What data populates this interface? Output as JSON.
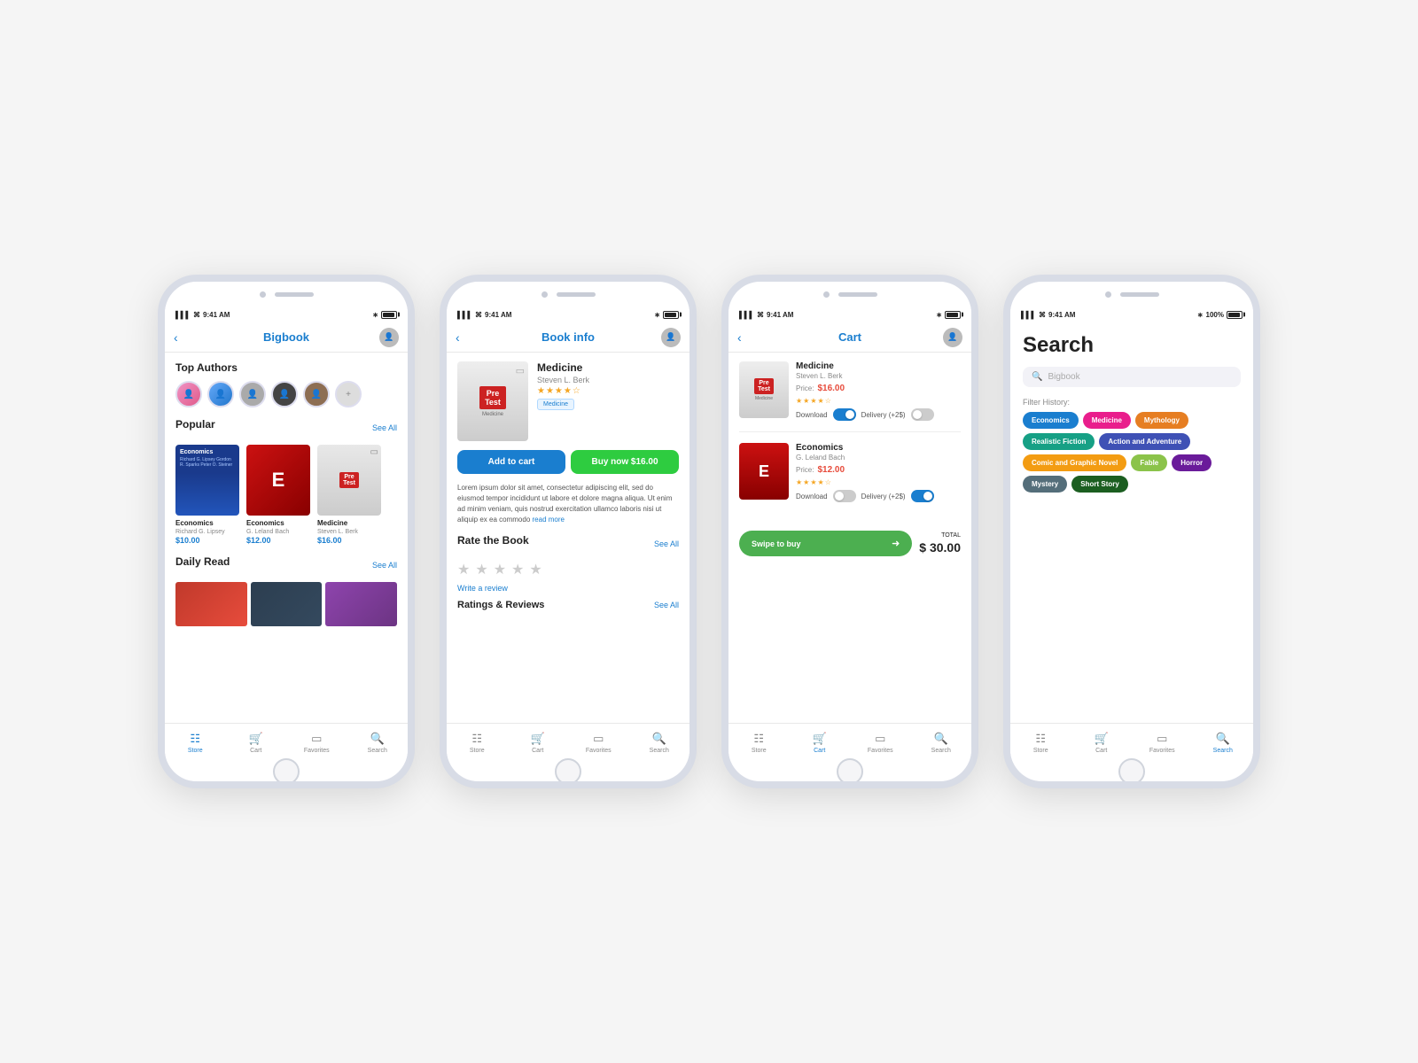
{
  "scene": {
    "background": "#f5f5f5"
  },
  "phones": [
    {
      "id": "bigbook",
      "status_time": "9:41 AM",
      "status_battery": "100%",
      "nav_title": "Bigbook",
      "nav_back": true,
      "section_top_authors": "Top Authors",
      "section_popular": "Popular",
      "section_daily_read": "Daily Read",
      "see_all": "See All",
      "books": [
        {
          "title": "Economics",
          "author": "Richard G. Lipsey",
          "price": "$10.00",
          "type": "econ_1"
        },
        {
          "title": "Economics",
          "author": "G. Leland Bach",
          "price": "$12.00",
          "type": "econ_red"
        },
        {
          "title": "Medicine",
          "author": "Steven L. Berk",
          "price": "$16.00",
          "type": "pretest"
        }
      ],
      "bottom_nav": [
        "Store",
        "Cart",
        "Favorites",
        "Search"
      ],
      "bottom_nav_active": 0
    },
    {
      "id": "book_info",
      "status_time": "9:41 AM",
      "nav_title": "Book info",
      "nav_back": true,
      "book_title": "Medicine",
      "book_author": "Steven L. Berk",
      "book_genre": "Medicine",
      "stars": 4.5,
      "btn_add": "Add to cart",
      "btn_buy": "Buy now  $16.00",
      "description": "Lorem ipsum dolor sit amet, consectetur adipiscing elit, sed do eiusmod tempor incididunt ut labore et dolore magna aliqua. Ut enim ad minim veniam, quis nostrud exercitation ullamco laboris nisi ut aliquip ex ea commodo",
      "read_more": "read more",
      "rate_section": "Rate the Book",
      "see_all_rate": "See All",
      "write_review": "Write a review",
      "ratings_reviews": "Ratings & Reviews",
      "see_all_reviews": "See All",
      "bottom_nav": [
        "Store",
        "Cart",
        "Favorites",
        "Search"
      ],
      "bottom_nav_active": -1
    },
    {
      "id": "cart",
      "status_time": "9:41 AM",
      "nav_title": "Cart",
      "nav_back": true,
      "cart_items": [
        {
          "title": "Medicine",
          "author": "Steven L. Berk",
          "price_label": "Price:",
          "price": "$16.00",
          "type": "pretest",
          "download_label": "Download",
          "download_on": true,
          "delivery_label": "Delivery (+2$)",
          "delivery_on": false
        },
        {
          "title": "Economics",
          "author": "G. Leland Bach",
          "price_label": "Price:",
          "price": "$12.00",
          "type": "econ_cart",
          "download_label": "Download",
          "download_on": false,
          "delivery_label": "Delivery (+2$)",
          "delivery_on": true
        }
      ],
      "swipe_label": "Swipe to buy",
      "total_label": "TOTAL",
      "total_amount": "$ 30.00",
      "bottom_nav": [
        "Store",
        "Cart",
        "Favorites",
        "Search"
      ],
      "bottom_nav_active": 1
    },
    {
      "id": "search",
      "status_time": "9:41 AM",
      "nav_title": "",
      "page_title": "Search",
      "search_placeholder": "Bigbook",
      "filter_history_label": "Filter History:",
      "tags": [
        {
          "label": "Economics",
          "color": "tag-blue"
        },
        {
          "label": "Medicine",
          "color": "tag-pink"
        },
        {
          "label": "Mythology",
          "color": "tag-orange"
        },
        {
          "label": "Realistic Fiction",
          "color": "tag-teal"
        },
        {
          "label": "Action and Adventure",
          "color": "tag-indigo"
        },
        {
          "label": "Comic and Graphic Novel",
          "color": "tag-amber"
        },
        {
          "label": "Fable",
          "color": "tag-lime"
        },
        {
          "label": "Horror",
          "color": "tag-purple"
        },
        {
          "label": "Mystery",
          "color": "tag-blue-gray"
        },
        {
          "label": "Short Story",
          "color": "tag-dark-green"
        }
      ],
      "bottom_nav": [
        "Store",
        "Cart",
        "Favorites",
        "Search"
      ],
      "bottom_nav_active": 3
    }
  ]
}
